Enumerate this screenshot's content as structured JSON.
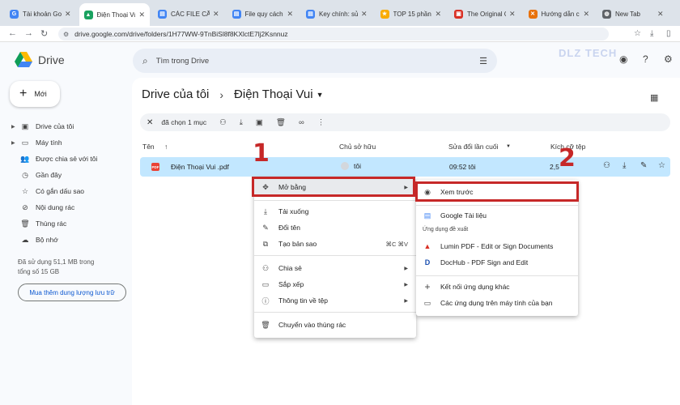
{
  "browser": {
    "tabs": [
      {
        "label": "Tài khoản Goo",
        "color": "#4285f4",
        "glyph": "G"
      },
      {
        "label": "Điện Thoại Vui",
        "color": "#1aa260",
        "glyph": "▲"
      },
      {
        "label": "CÁC FILE CẦN",
        "color": "#4285f4",
        "glyph": "▤"
      },
      {
        "label": "File quy cách",
        "color": "#4285f4",
        "glyph": "▤"
      },
      {
        "label": "Key chính: sử",
        "color": "#4285f4",
        "glyph": "▤"
      },
      {
        "label": "TOP 15 phần",
        "color": "#f9ab00",
        "glyph": "★"
      },
      {
        "label": "The Original C",
        "color": "#d93025",
        "glyph": "▣"
      },
      {
        "label": "Hướng dẫn cá",
        "color": "#e8710a",
        "glyph": "✕"
      },
      {
        "label": "New Tab",
        "color": "#5f6368",
        "glyph": "◍"
      }
    ],
    "url": "drive.google.com/drive/folders/1H77WW-9TnBiSl8f8KXlctE7lj2Ksnnuz",
    "watermark": "DLZ TECH"
  },
  "app": {
    "name": "Drive",
    "search_placeholder": "Tìm trong Drive",
    "new_button": "Mới"
  },
  "sidebar": {
    "items": [
      {
        "label": "Drive của tôi",
        "icon": "drive-icon",
        "glyph": "▣",
        "caret": true
      },
      {
        "label": "Máy tính",
        "icon": "computer-icon",
        "glyph": "▭",
        "caret": true
      },
      {
        "label": "Được chia sẻ với tôi",
        "icon": "shared-icon",
        "glyph": "👥",
        "caret": false
      },
      {
        "label": "Gần đây",
        "icon": "clock-icon",
        "glyph": "◷",
        "caret": false
      },
      {
        "label": "Có gắn dấu sao",
        "icon": "star-icon",
        "glyph": "☆",
        "caret": false
      },
      {
        "label": "Nội dung rác",
        "icon": "spam-icon",
        "glyph": "⊘",
        "caret": false
      },
      {
        "label": "Thùng rác",
        "icon": "trash-icon",
        "glyph": "🗑",
        "caret": false
      },
      {
        "label": "Bộ nhớ",
        "icon": "cloud-icon",
        "glyph": "☁",
        "caret": false
      }
    ],
    "storage_line1": "Đã sử dụng 51,1 MB trong",
    "storage_line2": "tổng số 15 GB",
    "buy_button": "Mua thêm dung lượng lưu trữ"
  },
  "main": {
    "breadcrumb_root": "Drive của tôi",
    "breadcrumb_current": "Điện Thoại Vui",
    "selection_text": "đã chọn 1 mục",
    "columns": {
      "name": "Tên",
      "owner": "Chủ sở hữu",
      "modified": "Sửa đổi lần cuối",
      "size": "Kích cỡ tệp"
    },
    "file": {
      "name": "Điện Thoại Vui .pdf",
      "owner": "tôi",
      "modified": "09:52 tôi",
      "size": "2,5"
    }
  },
  "context_menu": {
    "open_with": "Mở bằng",
    "download": "Tải xuống",
    "rename": "Đổi tên",
    "copy": "Tạo bản sao",
    "copy_shortcut": "⌘C ⌘V",
    "share": "Chia sẻ",
    "organize": "Sắp xếp",
    "file_info": "Thông tin về tệp",
    "trash": "Chuyển vào thùng rác"
  },
  "submenu": {
    "preview": "Xem trước",
    "google_docs": "Google Tài liệu",
    "suggested_header": "Ứng dụng đề xuất",
    "lumin": "Lumin PDF - Edit or Sign Documents",
    "dochub": "DocHub - PDF Sign and Edit",
    "connect_more": "Kết nối ứng dụng khác",
    "computer_apps": "Các ứng dụng trên máy tính của bạn"
  },
  "annotations": {
    "step1": "1",
    "step2": "2"
  }
}
